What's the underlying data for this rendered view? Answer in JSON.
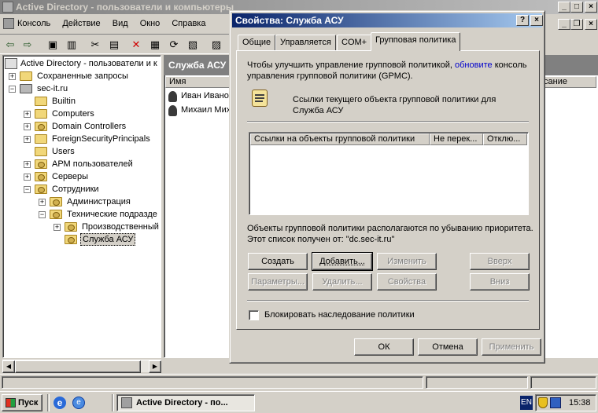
{
  "main_window": {
    "title": "Active Directory - пользователи и компьютеры",
    "menu": [
      "Консоль",
      "Действие",
      "Вид",
      "Окно",
      "Справка"
    ],
    "tree": {
      "root": "Active Directory - пользователи и к",
      "items": [
        {
          "label": "Сохраненные запросы",
          "indent": 1,
          "expander": "+",
          "type": "folder"
        },
        {
          "label": "sec-it.ru",
          "indent": 1,
          "expander": "-",
          "type": "domain"
        },
        {
          "label": "Builtin",
          "indent": 2,
          "expander": "",
          "type": "folder"
        },
        {
          "label": "Computers",
          "indent": 2,
          "expander": "+",
          "type": "folder"
        },
        {
          "label": "Domain Controllers",
          "indent": 2,
          "expander": "+",
          "type": "ou"
        },
        {
          "label": "ForeignSecurityPrincipals",
          "indent": 2,
          "expander": "+",
          "type": "folder"
        },
        {
          "label": "Users",
          "indent": 2,
          "expander": "",
          "type": "folder"
        },
        {
          "label": "АРМ пользователей",
          "indent": 2,
          "expander": "+",
          "type": "ou"
        },
        {
          "label": "Серверы",
          "indent": 2,
          "expander": "+",
          "type": "ou"
        },
        {
          "label": "Сотрудники",
          "indent": 2,
          "expander": "-",
          "type": "ou"
        },
        {
          "label": "Администрация",
          "indent": 3,
          "expander": "+",
          "type": "ou"
        },
        {
          "label": "Технические подразде",
          "indent": 3,
          "expander": "-",
          "type": "ou"
        },
        {
          "label": "Производственный",
          "indent": 4,
          "expander": "+",
          "type": "ou"
        },
        {
          "label": "Служба АСУ",
          "indent": 4,
          "expander": "",
          "type": "ou",
          "selected": true
        }
      ]
    },
    "right_pane": {
      "header": "Служба АСУ",
      "col_name": "Имя",
      "col_desc": "сание",
      "rows": [
        "Иван Ивано",
        "Михаил Мих"
      ]
    }
  },
  "dialog": {
    "title": "Свойства: Служба АСУ",
    "tabs": [
      "Общие",
      "Управляется",
      "COM+",
      "Групповая политика"
    ],
    "intro_before": "Чтобы улучшить управление групповой политикой, ",
    "intro_link": "обновите",
    "intro_after": " консоль управления групповой политики (GPMC).",
    "links_caption": "Ссылки текущего объекта групповой политики для Служба АСУ",
    "list_columns": [
      "Ссылки на объекты групповой политики",
      "Не перек...",
      "Отклю..."
    ],
    "order_note": "Объекты групповой политики располагаются по убыванию приоритета. Этот список получен от: \"dc.sec-it.ru\"",
    "buttons": {
      "create": "Создать",
      "add": "Добавить...",
      "change": "Изменить",
      "up": "Вверх",
      "params": "Параметры...",
      "delete": "Удалить...",
      "props": "Свойства",
      "down": "Вниз"
    },
    "block_inheritance": "Блокировать наследование политики",
    "ok": "ОК",
    "cancel": "Отмена",
    "apply": "Применить"
  },
  "taskbar": {
    "start": "Пуск",
    "task": "Active Directory - по...",
    "lang": "EN",
    "clock": "15:38"
  }
}
